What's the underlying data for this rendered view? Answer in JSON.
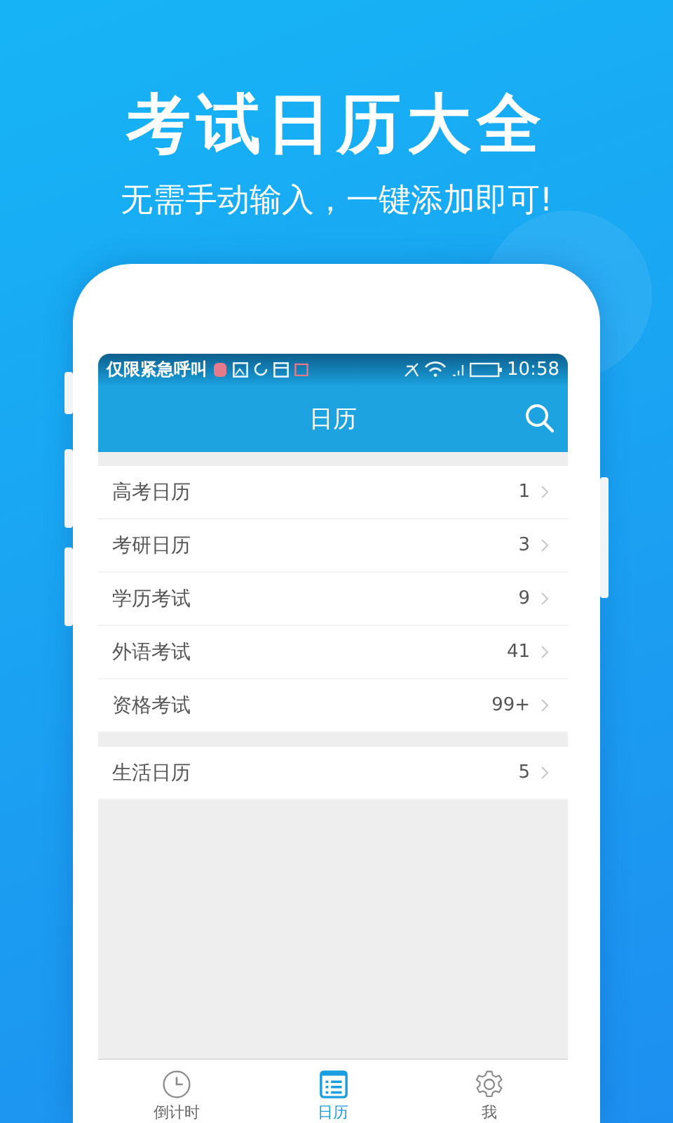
{
  "promo": {
    "title": "考试日历大全",
    "subtitle": "无需手动输入，一键添加即可!"
  },
  "status_bar": {
    "carrier": "仅限紧急呼叫",
    "time": "10:58"
  },
  "header": {
    "title": "日历"
  },
  "sections": [
    {
      "items": [
        {
          "label": "高考日历",
          "count": "1"
        },
        {
          "label": "考研日历",
          "count": "3"
        },
        {
          "label": "学历考试",
          "count": "9"
        },
        {
          "label": "外语考试",
          "count": "41"
        },
        {
          "label": "资格考试",
          "count": "99+"
        }
      ]
    },
    {
      "items": [
        {
          "label": "生活日历",
          "count": "5"
        }
      ]
    }
  ],
  "tabs": [
    {
      "label": "倒计时",
      "kind": "clock",
      "selected": false
    },
    {
      "label": "日历",
      "kind": "list",
      "selected": true
    },
    {
      "label": "我",
      "kind": "gear",
      "selected": false
    }
  ]
}
